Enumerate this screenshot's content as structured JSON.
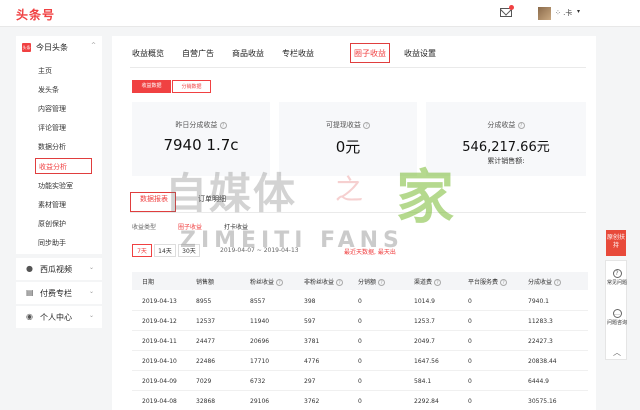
{
  "app": {
    "logo": "头条号"
  },
  "header": {
    "username": "⁘ .卡",
    "caret": "▾"
  },
  "sidebar": {
    "main_section": {
      "badge": "头条",
      "label": "今日头条",
      "chevron": "^",
      "items": [
        "主页",
        "发头条",
        "内容管理",
        "评论管理",
        "数据分析",
        "收益分析",
        "功能实验室",
        "素材管理",
        "原创保护",
        "同步助手"
      ],
      "active_item": "收益分析"
    },
    "sections": [
      {
        "label": "西瓜视频",
        "chevron": "⌄"
      },
      {
        "label": "付费专栏",
        "chevron": "⌄"
      },
      {
        "label": "个人中心",
        "chevron": "⌄"
      }
    ]
  },
  "tabs": [
    "收益概览",
    "自营广告",
    "商品收益",
    "专栏收益",
    "圈子收益",
    "收益设置"
  ],
  "active_tab": "圈子收益",
  "subtabs": [
    "收益数据",
    "分销数据"
  ],
  "cards": [
    {
      "title": "昨日分成收益",
      "value": "7​9​4​0 1.7c"
    },
    {
      "title": "可提现收益",
      "value": "0元"
    },
    {
      "title": "分成收益",
      "value": "546,217.66元",
      "sub_label": "累计销售额:"
    }
  ],
  "watermark": {
    "line1": "自媒体",
    "mid": "之",
    "big": "家",
    "line2": "ZIMEITI FANS"
  },
  "report_tabs": [
    "数据报表",
    "订单明细"
  ],
  "revenue_type": {
    "label": "收益类型",
    "options": [
      "圈子收益",
      "打卡收益"
    ]
  },
  "ranges": [
    "7天",
    "14天",
    "30天"
  ],
  "date_range": "2019-04-07  ~  2019-04-13",
  "range_note": "最近天数据, 最天出",
  "table": {
    "headers": [
      "日期",
      "销售额",
      "粉丝收益",
      "非粉丝收益",
      "分销额",
      "渠道费",
      "平台服务费",
      "分成收益"
    ],
    "rows": [
      [
        "2019-04-13",
        "8955",
        "8557",
        "398",
        "0",
        "1014.9",
        "0",
        "7940.1"
      ],
      [
        "2019-04-12",
        "12537",
        "11940",
        "597",
        "0",
        "1253.7",
        "0",
        "11283.3"
      ],
      [
        "2019-04-11",
        "24477",
        "20696",
        "3781",
        "0",
        "2049.7",
        "0",
        "22427.3"
      ],
      [
        "2019-04-10",
        "22486",
        "17710",
        "4776",
        "0",
        "1647.56",
        "0",
        "20838.44"
      ],
      [
        "2019-04-09",
        "7029",
        "6732",
        "297",
        "0",
        "584.1",
        "0",
        "6444.9"
      ],
      [
        "2019-04-08",
        "32868",
        "29106",
        "3762",
        "0",
        "2292.84",
        "0",
        "30575.16"
      ]
    ]
  },
  "float": {
    "badge": "原创扶持",
    "items": [
      "常见问题",
      "问题咨询"
    ],
    "up": "︿"
  },
  "colors": {
    "brand": "#f04142",
    "highlight_box": "#e03e3e"
  }
}
